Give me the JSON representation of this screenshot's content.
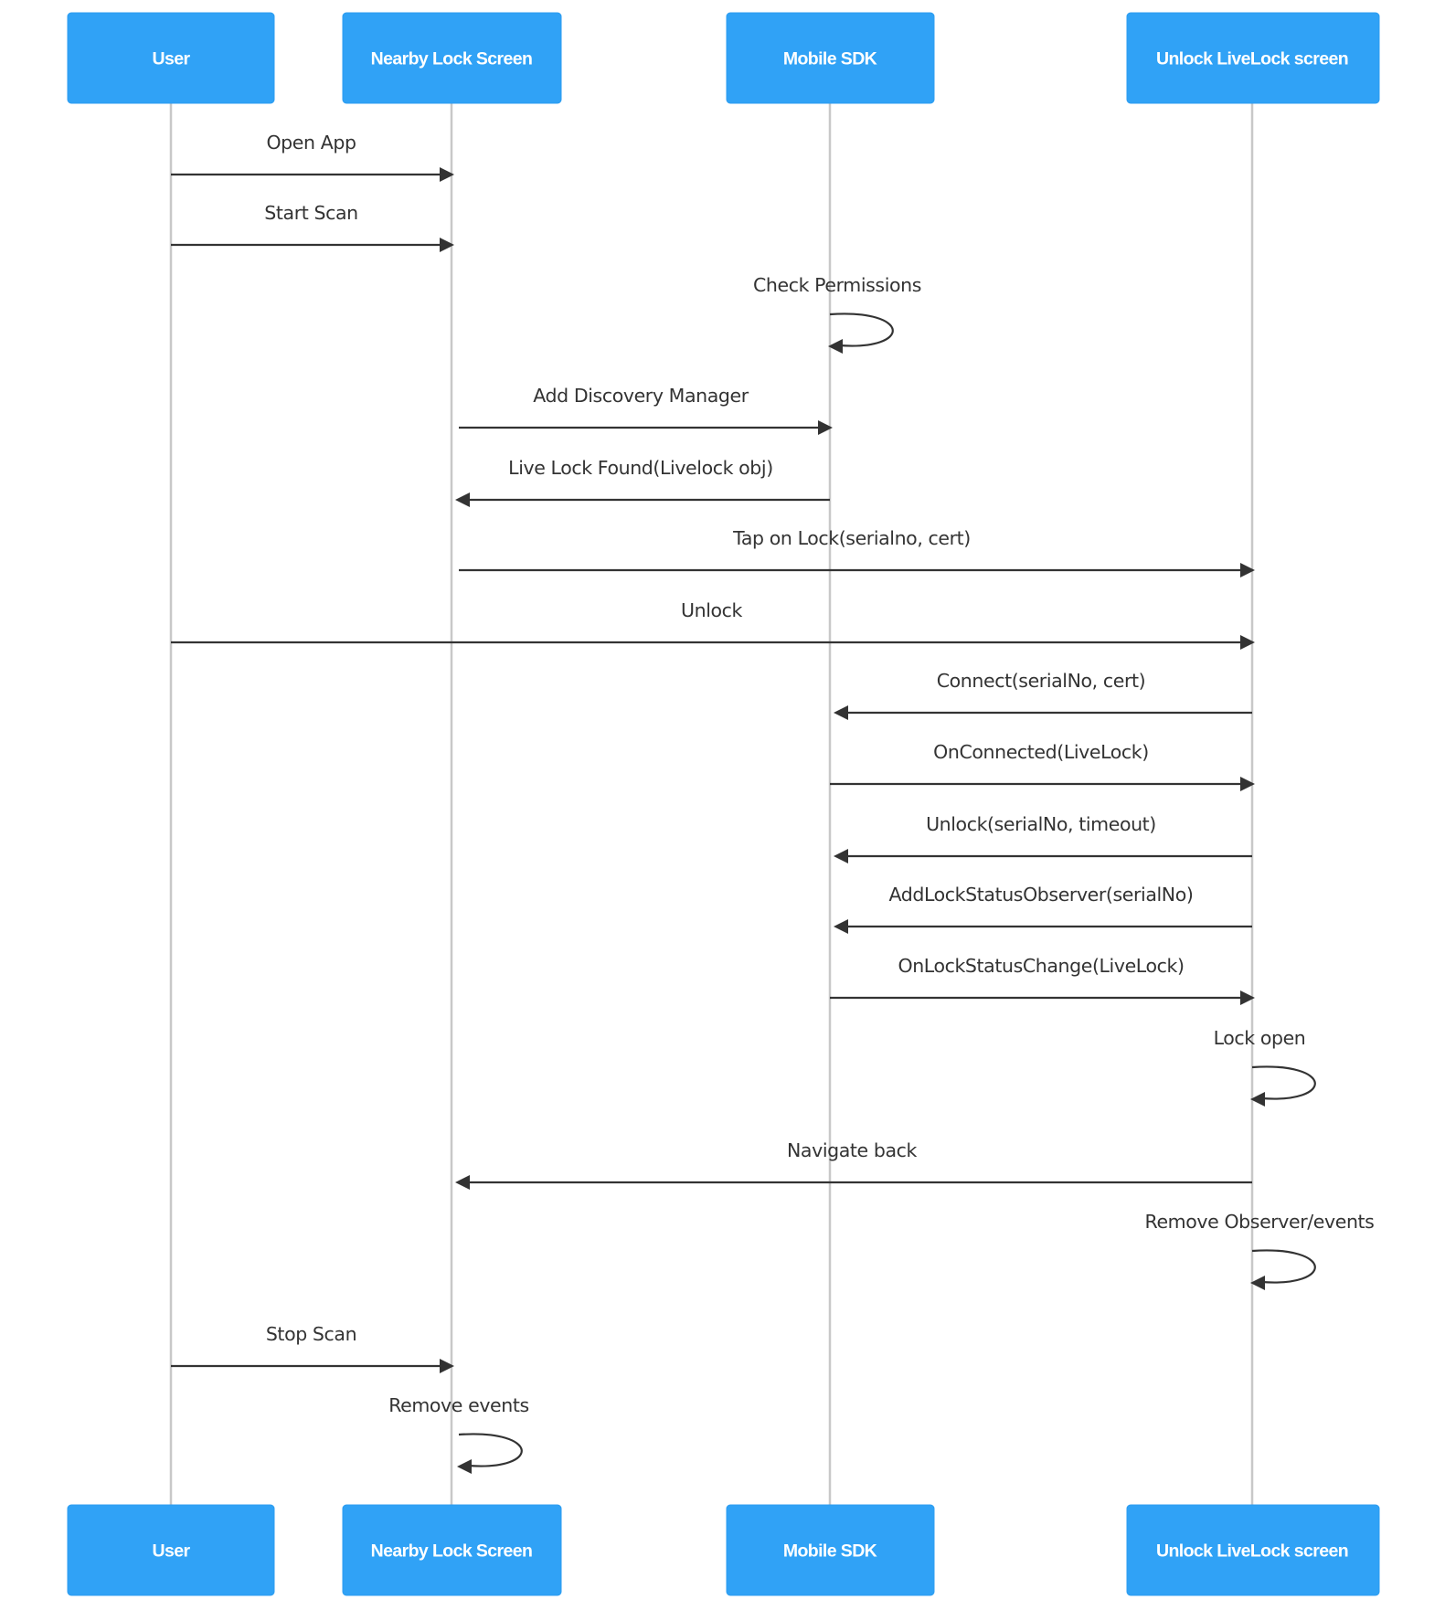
{
  "diagram": {
    "type": "sequence",
    "colors": {
      "actor_fill": "#30a2f6",
      "actor_text": "#ffffff",
      "lifeline": "#c8c8c8",
      "message": "#333333"
    },
    "participants": [
      {
        "id": "user",
        "label": "User"
      },
      {
        "id": "nearby",
        "label": "Nearby Lock Screen"
      },
      {
        "id": "sdk",
        "label": "Mobile SDK"
      },
      {
        "id": "unlock",
        "label": "Unlock LiveLock screen"
      }
    ],
    "messages": [
      {
        "from": "user",
        "to": "nearby",
        "label": "Open App"
      },
      {
        "from": "user",
        "to": "nearby",
        "label": "Start Scan"
      },
      {
        "from": "sdk",
        "to": "sdk",
        "label": "Check Permissions"
      },
      {
        "from": "nearby",
        "to": "sdk",
        "label": "Add Discovery Manager"
      },
      {
        "from": "sdk",
        "to": "nearby",
        "label": "Live Lock Found(Livelock obj)"
      },
      {
        "from": "nearby",
        "to": "unlock",
        "label": "Tap on Lock(serialno, cert)"
      },
      {
        "from": "user",
        "to": "unlock",
        "label": "Unlock"
      },
      {
        "from": "unlock",
        "to": "sdk",
        "label": "Connect(serialNo, cert)"
      },
      {
        "from": "sdk",
        "to": "unlock",
        "label": "OnConnected(LiveLock)"
      },
      {
        "from": "unlock",
        "to": "sdk",
        "label": "Unlock(serialNo, timeout)"
      },
      {
        "from": "unlock",
        "to": "sdk",
        "label": "AddLockStatusObserver(serialNo)"
      },
      {
        "from": "sdk",
        "to": "unlock",
        "label": "OnLockStatusChange(LiveLock)"
      },
      {
        "from": "unlock",
        "to": "unlock",
        "label": "Lock open"
      },
      {
        "from": "unlock",
        "to": "nearby",
        "label": "Navigate back"
      },
      {
        "from": "unlock",
        "to": "unlock",
        "label": "Remove Observer/events"
      },
      {
        "from": "user",
        "to": "nearby",
        "label": "Stop Scan"
      },
      {
        "from": "nearby",
        "to": "nearby",
        "label": "Remove events"
      }
    ]
  }
}
